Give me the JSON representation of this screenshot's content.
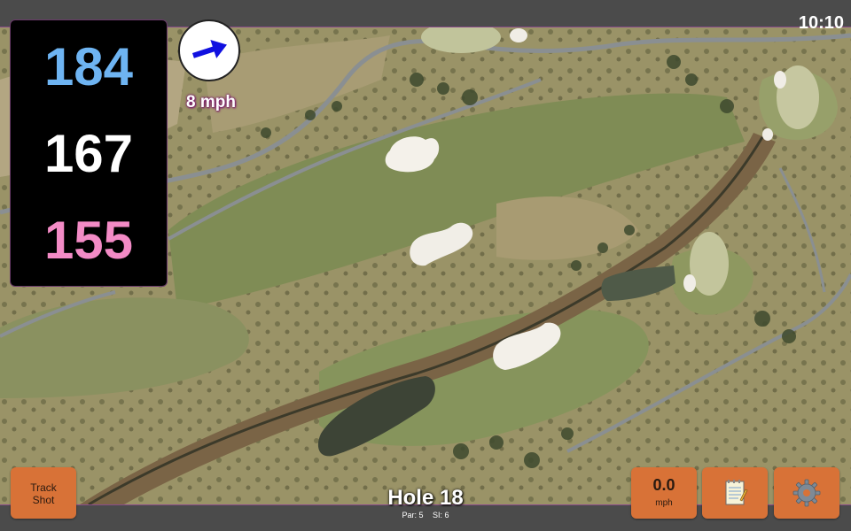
{
  "status_bar": {
    "time": "10:10"
  },
  "distances": {
    "back": "184",
    "middle": "167",
    "front": "155"
  },
  "wind": {
    "speed_label": "8 mph",
    "direction_icon": "arrow-icon",
    "arrow_color": "#1010e0"
  },
  "buttons": {
    "track_shot_line1": "Track",
    "track_shot_line2": "Shot",
    "speed_value": "0.0",
    "speed_unit": "mph",
    "notes_icon": "notepad-icon",
    "settings_icon": "gear-icon"
  },
  "hole": {
    "title": "Hole 18",
    "par": "Par: 5",
    "stroke_index": "SI: 6"
  },
  "colors": {
    "button": "#d87237",
    "back_distance": "#6eb4f2",
    "middle_distance": "#ffffff",
    "front_distance": "#f38bc6",
    "panel": "#000000"
  }
}
